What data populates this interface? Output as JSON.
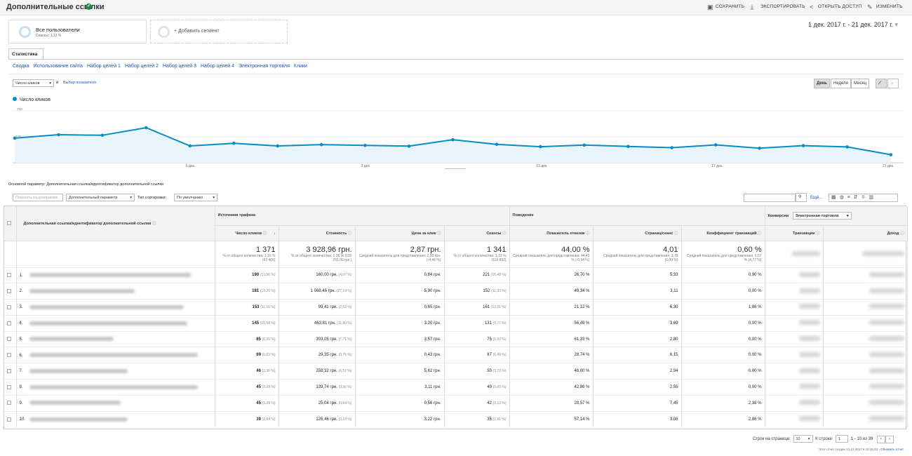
{
  "header": {
    "title": "Дополнительные ссылки",
    "verified_mark": "✔",
    "save": "СОХРАНИТЬ",
    "export": "ЭКСПОРТИРОВАТЬ",
    "share": "ОТКРЫТЬ ДОСТУП",
    "edit": "ИЗМЕНИТЬ"
  },
  "segments": {
    "all_users": "Все пользователи",
    "all_users_sub": "Сеансы: 1,13 %",
    "add_segment": "+ Добавить сегмент"
  },
  "date_range": "1 дек. 2017 г. - 21 дек. 2017 г.",
  "tab": "Статистика",
  "subnav": [
    "Сводка",
    "Использование сайта",
    "Набор целей 1",
    "Набор целей 2",
    "Набор целей 3",
    "Набор целей 4",
    "Электронная торговля",
    "Клики"
  ],
  "chart_controls": {
    "metric": "Число кликов",
    "and": "и",
    "choose": "Выбор показателя",
    "day": "День",
    "week": "Неделя",
    "month": "Месяц"
  },
  "chart_data": {
    "type": "line",
    "legend": "Число кликов",
    "ytick_top": "200",
    "ytick_mid": "100",
    "ylim": [
      0,
      200
    ],
    "x_ticks": [
      {
        "day": 5,
        "label": "5 дек."
      },
      {
        "day": 9,
        "label": "9 дек."
      },
      {
        "day": 13,
        "label": "13 дек."
      },
      {
        "day": 17,
        "label": "17 дек."
      },
      {
        "day": 21,
        "label": "21 дек."
      }
    ],
    "series": [
      {
        "name": "Число кликов",
        "values": [
          95,
          108,
          106,
          135,
          65,
          75,
          65,
          70,
          67,
          64,
          89,
          71,
          62,
          68,
          63,
          58,
          69,
          56,
          66,
          61,
          31
        ]
      }
    ]
  },
  "primary_dimension": {
    "label": "Основной параметр:",
    "value": "Дополнительная ссылка/идентификатор дополнительной ссылки"
  },
  "toolbar": {
    "chart_rows": "Показать на диаграмме",
    "secondary": "Дополнительный параметр",
    "sort_type": "Тип сортировки:",
    "sort_value": "По умолчанию",
    "more": "Ещё..."
  },
  "table": {
    "dimension_header": "Дополнительная ссылка/идентификатор дополнительной ссылки",
    "group_acq": "Источники трафика",
    "group_beh": "Поведение",
    "group_conv": "Конверсии",
    "conv_select": "Электронная торговля",
    "columns": [
      "Число кликов",
      "Стоимость",
      "Цена за клик",
      "Сеансы",
      "Показатель отказов",
      "Страниц/сеанс",
      "Коэффициент транзакций",
      "Транзакции",
      "Доход"
    ],
    "totals": [
      {
        "big": "1 371",
        "sm": "% от общего количества: 2,16 % (63 406)"
      },
      {
        "big": "3 928,96 грн.",
        "sm": "% от общего количества: 2,06 % (190 781,00 грн.)"
      },
      {
        "big": "2,87 грн.",
        "sm": "Средний показатель для представления: 2,00 грн. (-4,46 %)"
      },
      {
        "big": "1 341",
        "sm": "% от общего количества: 1,13 % (118 892)"
      },
      {
        "big": "44,00 %",
        "sm": "Средний показатель для представления: 44,41 % (-0,94 %)"
      },
      {
        "big": "4,01",
        "sm": "Средний показатель для представления: 3,78 (6,00 %)"
      },
      {
        "big": "0,60 %",
        "sm": "Средний показатель для представления: 0,57 % (4,77 %)"
      }
    ],
    "rows": [
      {
        "n": "1.",
        "clicks": "190",
        "cp": "(13,86 %)",
        "cost": "160,00 грн.",
        "costp": "(4,07 %)",
        "cpc": "0,84 грн.",
        "ses": "221",
        "sesp": "(16,48 %)",
        "br": "26,70 %",
        "pps": "5,33",
        "cr": "0,90 %"
      },
      {
        "n": "2.",
        "clicks": "181",
        "cp": "(13,20 %)",
        "cost": "1 068,46 грн.",
        "costp": "(27,19 %)",
        "cpc": "5,90 грн.",
        "ses": "152",
        "sesp": "(11,33 %)",
        "br": "49,34 %",
        "pps": "3,11",
        "cr": "0,00 %"
      },
      {
        "n": "3.",
        "clicks": "153",
        "cp": "(11,16 %)",
        "cost": "99,41 грн.",
        "costp": "(2,53 %)",
        "cpc": "0,65 грн.",
        "ses": "161",
        "sesp": "(12,01 %)",
        "br": "21,12 %",
        "pps": "6,30",
        "cr": "1,86 %"
      },
      {
        "n": "4.",
        "clicks": "145",
        "cp": "(10,58 %)",
        "cost": "463,81 грн.",
        "costp": "(11,80 %)",
        "cpc": "3,20 грн.",
        "ses": "131",
        "sesp": "(9,77 %)",
        "br": "56,49 %",
        "pps": "3,69",
        "cr": "0,00 %"
      },
      {
        "n": "5.",
        "clicks": "85",
        "cp": "(6,20 %)",
        "cost": "303,05 грн.",
        "costp": "(7,71 %)",
        "cpc": "3,57 грн.",
        "ses": "75",
        "sesp": "(5,59 %)",
        "br": "61,33 %",
        "pps": "2,80",
        "cr": "0,00 %"
      },
      {
        "n": "6.",
        "clicks": "69",
        "cp": "(5,03 %)",
        "cost": "29,35 грн.",
        "costp": "(0,75 %)",
        "cpc": "0,43 грн.",
        "ses": "87",
        "sesp": "(6,49 %)",
        "br": "28,74 %",
        "pps": "6,15",
        "cr": "0,00 %"
      },
      {
        "n": "7.",
        "clicks": "46",
        "cp": "(3,36 %)",
        "cost": "258,32 грн.",
        "costp": "(6,57 %)",
        "cpc": "5,62 грн.",
        "ses": "50",
        "sesp": "(3,73 %)",
        "br": "46,00 %",
        "pps": "2,94",
        "cr": "0,00 %"
      },
      {
        "n": "8.",
        "clicks": "45",
        "cp": "(3,28 %)",
        "cost": "139,74 грн.",
        "costp": "(3,56 %)",
        "cpc": "3,11 грн.",
        "ses": "49",
        "sesp": "(3,65 %)",
        "br": "42,86 %",
        "pps": "2,55",
        "cr": "0,00 %"
      },
      {
        "n": "9.",
        "clicks": "45",
        "cp": "(3,28 %)",
        "cost": "25,04 грн.",
        "costp": "(0,64 %)",
        "cpc": "0,56 грн.",
        "ses": "42",
        "sesp": "(3,13 %)",
        "br": "28,57 %",
        "pps": "7,45",
        "cr": "2,38 %"
      },
      {
        "n": "10.",
        "clicks": "39",
        "cp": "(2,84 %)",
        "cost": "125,46 грн.",
        "costp": "(3,19 %)",
        "cpc": "3,22 грн.",
        "ses": "35",
        "sesp": "(2,61 %)",
        "br": "57,14 %",
        "pps": "3,08",
        "cr": "2,86 %"
      }
    ]
  },
  "pagination": {
    "rows_label": "Строк на странице:",
    "rows_value": "10",
    "goto_label": "К строке:",
    "goto_value": "1",
    "range": "1 - 10 из 39"
  },
  "footer": {
    "created": "Этот отчет создан 21.12.2017 в 10:15:43 -",
    "refresh": "Обновить отчет"
  }
}
